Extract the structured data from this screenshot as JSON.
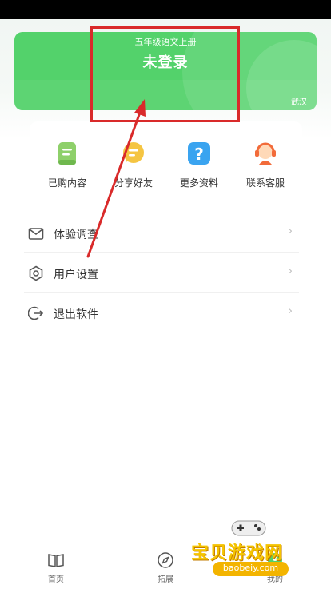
{
  "banner": {
    "grade": "五年级语文上册",
    "login_status": "未登录",
    "city": "武汉"
  },
  "quick_actions": [
    {
      "label": "已购内容",
      "icon": "purchased-doc-icon",
      "color": "#8ed06a"
    },
    {
      "label": "分享好友",
      "icon": "share-chat-icon",
      "color": "#f5c542"
    },
    {
      "label": "更多资料",
      "icon": "question-icon",
      "color": "#3aa4f0"
    },
    {
      "label": "联系客服",
      "icon": "customer-service-icon",
      "color": "#f26b3a"
    }
  ],
  "menu": [
    {
      "label": "体验调查",
      "icon": "mail-icon"
    },
    {
      "label": "用户设置",
      "icon": "settings-hex-icon"
    },
    {
      "label": "退出软件",
      "icon": "exit-icon"
    }
  ],
  "menu_chevron": "›",
  "tabs": [
    {
      "label": "首页",
      "icon": "book-icon"
    },
    {
      "label": "拓展",
      "icon": "compass-icon"
    },
    {
      "label": "我的",
      "icon": "profile-icon"
    }
  ],
  "watermark": {
    "title": "宝贝游戏网",
    "url": "baobeiy.com"
  },
  "colors": {
    "banner_green": "#53d26b",
    "annotation_red": "#d92a2a"
  }
}
